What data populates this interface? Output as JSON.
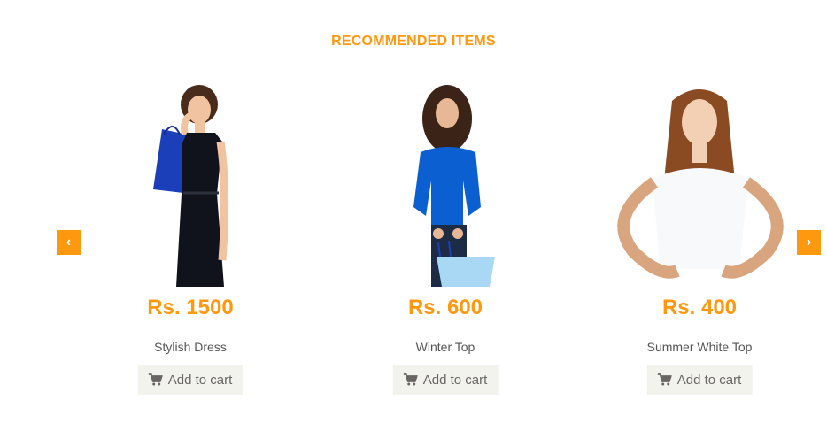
{
  "section": {
    "title": "RECOMMENDED ITEMS"
  },
  "products": [
    {
      "price": "Rs. 1500",
      "name": "Stylish Dress",
      "button": "Add to cart"
    },
    {
      "price": "Rs. 600",
      "name": "Winter Top",
      "button": "Add to cart"
    },
    {
      "price": "Rs. 400",
      "name": "Summer White Top",
      "button": "Add to cart"
    }
  ],
  "colors": {
    "accent": "#FE980F",
    "button_bg": "#F3F3EE",
    "button_text": "#696763"
  },
  "icons": {
    "prev": "chevron-left-icon",
    "next": "chevron-right-icon",
    "cart": "shopping-cart-icon"
  }
}
